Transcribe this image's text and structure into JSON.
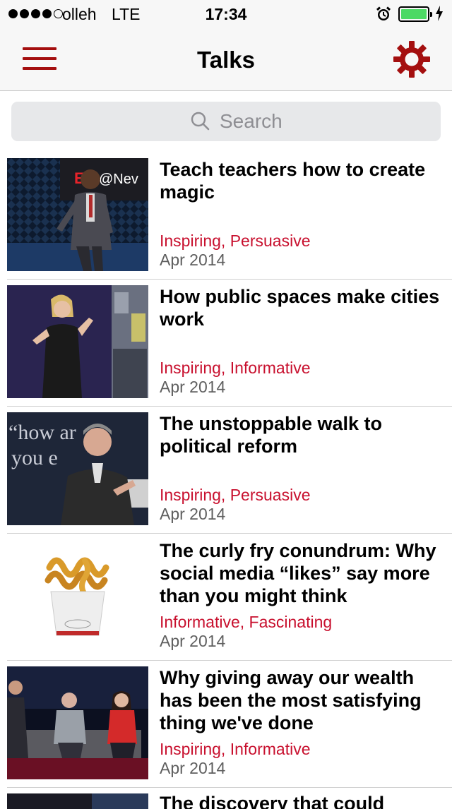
{
  "status_bar": {
    "carrier": "olleh",
    "network": "LTE",
    "time": "17:34",
    "signal_bars_filled": 4,
    "signal_bars_total": 5,
    "battery_level": 1.0,
    "battery_color": "#4cd964"
  },
  "nav": {
    "title": "Talks",
    "menu_icon": "hamburger-menu-icon",
    "settings_icon": "gear-icon",
    "accent_color": "#a40f0f"
  },
  "search": {
    "placeholder": "Search"
  },
  "talks": [
    {
      "title": "Teach teachers how to create magic",
      "tags": "Inspiring, Persuasive",
      "date": "Apr 2014",
      "thumbnail_text": "EDx@Nev"
    },
    {
      "title": "How public spaces make cities work",
      "tags": "Inspiring, Informative",
      "date": "Apr 2014"
    },
    {
      "title": "The unstoppable walk to political reform",
      "tags": "Inspiring, Persuasive",
      "date": "Apr 2014",
      "thumbnail_text_lines": [
        "“how ar",
        "you e"
      ]
    },
    {
      "title": "The curly fry conundrum: Why social media “likes” say more than you might think",
      "tags": "Informative, Fascinating",
      "date": "Apr 2014"
    },
    {
      "title": "Why giving away our wealth has been the most satisfying thing we've done",
      "tags": "Inspiring, Informative",
      "date": "Apr 2014"
    },
    {
      "title": "The discovery that could",
      "tags": "",
      "date": ""
    }
  ],
  "colors": {
    "tag_color": "#c8102e",
    "date_color": "#5f5f5f"
  }
}
